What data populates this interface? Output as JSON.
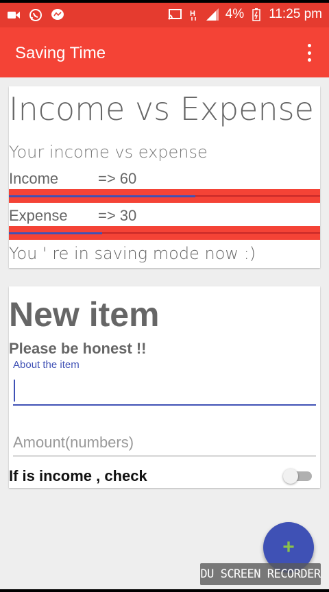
{
  "status_bar": {
    "icons_left": [
      "video-camera-icon",
      "whatsapp-icon",
      "messenger-icon"
    ],
    "icons_right": [
      "cast-icon",
      "signal-h-icon",
      "signal-bars-icon"
    ],
    "battery": "4%",
    "time": "11:25 pm"
  },
  "app_bar": {
    "title": "Saving Time",
    "menu_icon": "overflow-menu-icon"
  },
  "summary_card": {
    "title": "Income vs Expense",
    "subtitle": "Your income vs expense",
    "income_label": "Income",
    "income_value": "=> 60",
    "income_progress": 0.6,
    "expense_label": "Expense",
    "expense_value": "=> 30",
    "expense_progress": 0.3,
    "status_text": "You ' re in saving mode now  :)"
  },
  "new_item_card": {
    "title": "New item",
    "subtitle": "Please be honest !!",
    "about_label": "About the item",
    "about_value": "",
    "amount_placeholder": "Amount(numbers)",
    "income_check_label": "If is income , check",
    "income_toggle_on": false
  },
  "fab": {
    "icon": "plus-icon",
    "label": "+"
  },
  "watermark": "DU SCREEN RECORDER",
  "colors": {
    "status_bar": "#e53b2f",
    "app_bar": "#f44336",
    "accent": "#3f51b5",
    "fab_icon": "#8bc34a"
  }
}
